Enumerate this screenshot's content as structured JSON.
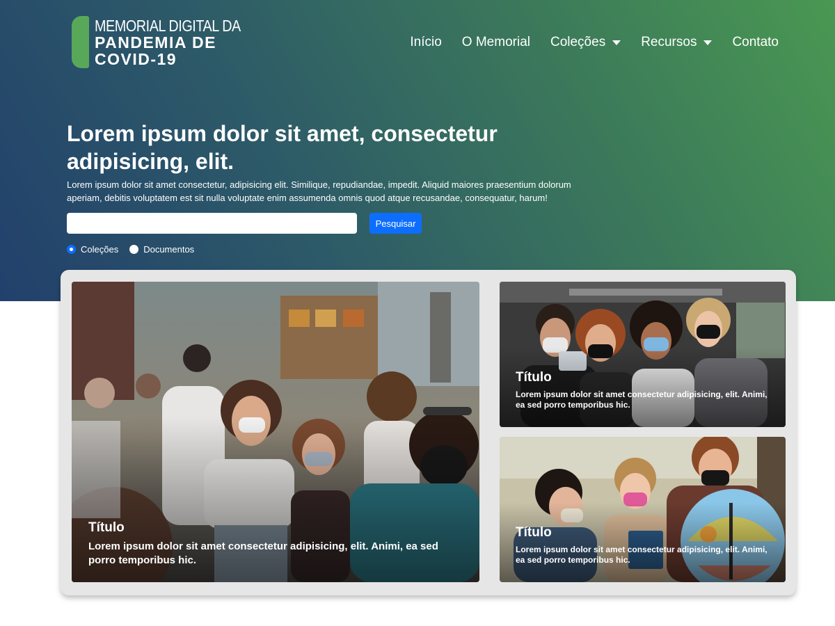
{
  "header": {
    "logo": {
      "line1": "MEMORIAL DIGITAL DA",
      "line2": "PANDEMIA DE",
      "line3": "COVID-19"
    },
    "nav": [
      {
        "label": "Início",
        "dropdown": false
      },
      {
        "label": "O Memorial",
        "dropdown": false
      },
      {
        "label": "Coleções",
        "dropdown": true
      },
      {
        "label": "Recursos",
        "dropdown": true
      },
      {
        "label": "Contato",
        "dropdown": false
      }
    ]
  },
  "hero": {
    "title": "Lorem ipsum dolor sit amet, consectetur adipisicing, elit.",
    "description": "Lorem ipsum dolor sit amet consectetur, adipisicing elit. Similique, repudiandae, impedit. Aliquid maiores praesentium dolorum aperiam, debitis voluptatem est sit nulla voluptate enim assumenda omnis quod atque recusandae, consequatur, harum!",
    "search": {
      "value": "",
      "placeholder": "",
      "button_label": "Pesquisar"
    },
    "scope_options": [
      {
        "label": "Coleções",
        "checked": true
      },
      {
        "label": "Documentos",
        "checked": false
      }
    ]
  },
  "gallery": {
    "cards": [
      {
        "title": "Título",
        "text": "Lorem ipsum dolor sit amet consectetur adipisicing, elit. Animi, ea sed porro temporibus hic."
      },
      {
        "title": "Título",
        "text": "Lorem ipsum dolor sit amet consectetur adipisicing, elit. Animi, ea sed porro temporibus hic."
      },
      {
        "title": "Título",
        "text": "Lorem ipsum dolor sit amet consectetur adipisicing, elit. Animi, ea sed porro temporibus hic."
      }
    ]
  },
  "colors": {
    "gradient_start": "#22406c",
    "gradient_end": "#4a9852",
    "logo_accent": "#59a85a",
    "primary_button": "#0d6efd",
    "gallery_frame": "#e6e6e6"
  }
}
